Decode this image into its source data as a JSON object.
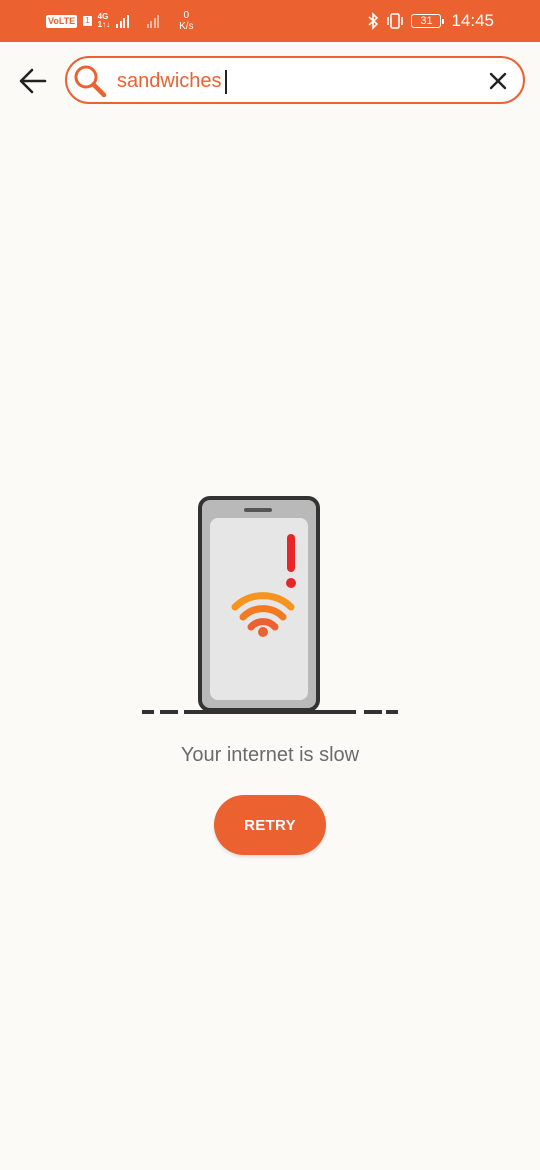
{
  "status_bar": {
    "volte": "VoLTE",
    "sim_slot": "1",
    "network_type": "4G",
    "network_sub": "1↑↓",
    "speed_value": "0",
    "speed_unit": "K/s",
    "battery_level": "31",
    "time": "14:45"
  },
  "search": {
    "query": "sandwiches",
    "icon": "search-icon"
  },
  "toolbar": {
    "back_icon": "arrow-left-icon",
    "clear_icon": "close-icon"
  },
  "error": {
    "illustration": "phone-slow-wifi-illustration",
    "message": "Your internet is slow",
    "retry_label": "RETRY"
  },
  "colors": {
    "accent": "#ec6130",
    "wifi_orange": "#f7941d",
    "alert_red": "#e8262a",
    "background": "#fbfaf7"
  }
}
